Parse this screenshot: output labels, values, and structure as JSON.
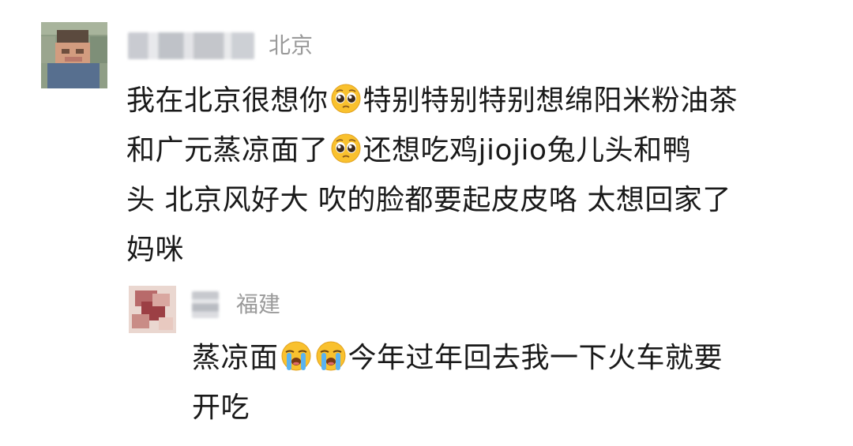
{
  "comments": [
    {
      "location": "北京",
      "lines": [
        [
          "我在北京很想你",
          "pleading-face-icon",
          "特别特别特别想绵阳米粉油茶"
        ],
        [
          "和广元蒸凉面了",
          "pleading-face-icon",
          "还想吃鸡jiojio兔儿头和鸭"
        ],
        [
          "头 北京风好大 吹的脸都要起皮皮咯 太想回家了"
        ],
        [
          "妈咪"
        ]
      ]
    },
    {
      "location": "福建",
      "lines": [
        [
          "蒸凉面",
          "loudly-crying-face-icon",
          "loudly-crying-face-icon",
          "今年过年回去我一下火车就要"
        ],
        [
          "开吃"
        ]
      ]
    }
  ],
  "colors": {
    "text": "#1a1a1a",
    "location": "#9a9a9a",
    "emoji_face": "#f9c12e"
  }
}
